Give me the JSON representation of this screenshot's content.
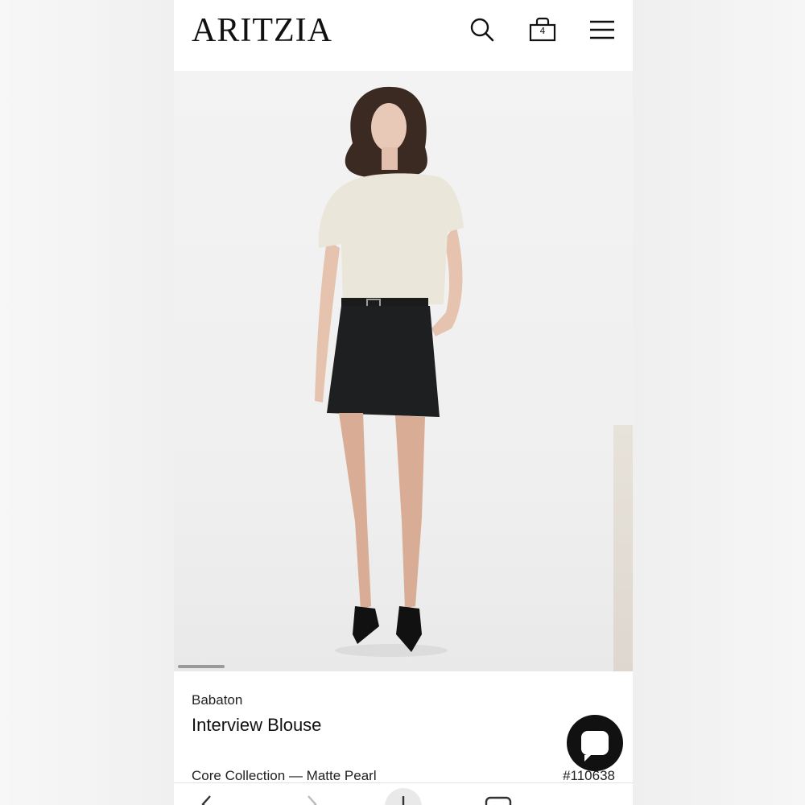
{
  "header": {
    "logo": "ARITZIA",
    "bag_count": "4",
    "icons": [
      "search-icon",
      "shopping-bag-icon",
      "hamburger-menu-icon"
    ]
  },
  "product": {
    "brand": "Babaton",
    "name": "Interview Blouse",
    "collection": "Core Collection — Matte Pearl",
    "sku": "#110638",
    "image_alt_icon": "product-photo"
  },
  "chat": {
    "icon": "chat-bubble-icon"
  },
  "toolbar": {
    "icons": [
      "back-arrow-icon",
      "forward-arrow-icon",
      "add-icon",
      "tabs-icon"
    ]
  },
  "colors": {
    "background": "#ffffff",
    "text": "#111111",
    "chat_button": "#111111",
    "blouse": "#ebe6da",
    "skirt": "#1e1f21"
  }
}
